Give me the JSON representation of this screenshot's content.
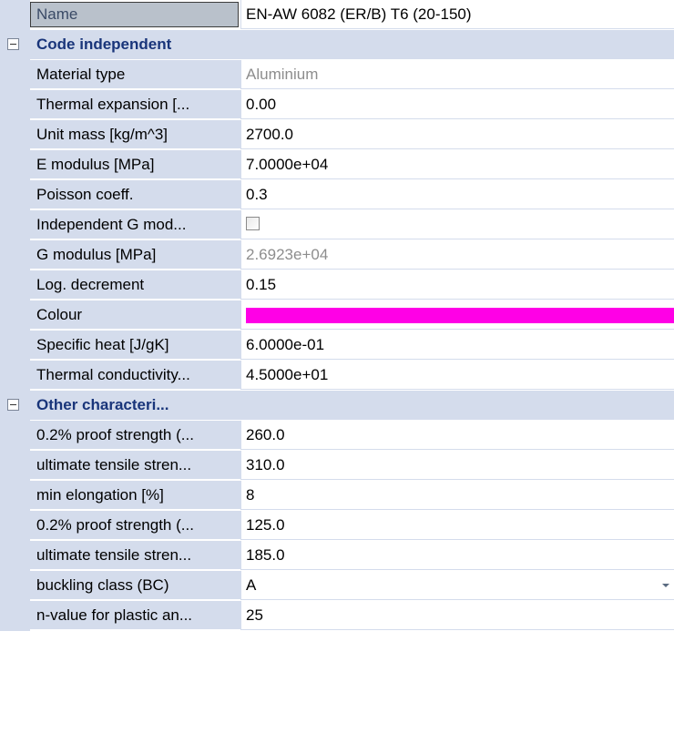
{
  "name_row": {
    "label": "Name",
    "value": "EN-AW 6082 (ER/B) T6 (20-150)"
  },
  "sections": [
    {
      "title": "Code independent",
      "rows": [
        {
          "label": "Material type",
          "value": "Aluminium",
          "disabled": true
        },
        {
          "label": "Thermal expansion  [...",
          "value": "0.00"
        },
        {
          "label": "Unit mass [kg/m^3]",
          "value": "2700.0"
        },
        {
          "label": "E modulus [MPa]",
          "value": "7.0000e+04"
        },
        {
          "label": "Poisson coeff.",
          "value": "0.3"
        },
        {
          "label": "Independent G mod...",
          "value": "",
          "checkbox": true,
          "checked": false
        },
        {
          "label": "G modulus [MPa]",
          "value": "2.6923e+04",
          "disabled": true
        },
        {
          "label": "Log. decrement",
          "value": "0.15"
        },
        {
          "label": "Colour",
          "value": "",
          "color": "#ff00e6"
        },
        {
          "label": "Specific heat [J/gK]",
          "value": "6.0000e-01"
        },
        {
          "label": "Thermal conductivity...",
          "value": "4.5000e+01"
        }
      ]
    },
    {
      "title": "Other characteri...",
      "rows": [
        {
          "label": "0.2% proof strength (...",
          "value": "260.0"
        },
        {
          "label": "ultimate tensile stren...",
          "value": "310.0"
        },
        {
          "label": "min elongation [%]",
          "value": "8"
        },
        {
          "label": "0.2% proof strength (...",
          "value": "125.0"
        },
        {
          "label": "ultimate tensile stren...",
          "value": "185.0"
        },
        {
          "label": "buckling class (BC)",
          "value": "A",
          "dropdown": true
        },
        {
          "label": "n-value for plastic an...",
          "value": "25"
        }
      ]
    }
  ]
}
